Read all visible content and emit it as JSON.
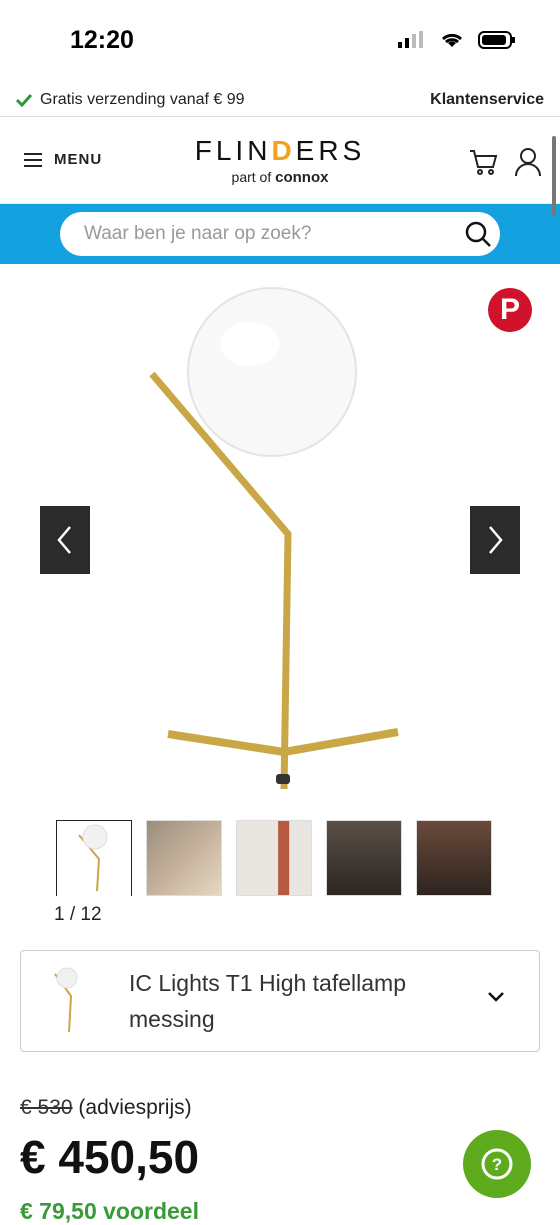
{
  "status_bar": {
    "time": "12:20"
  },
  "shipping": {
    "text": "Gratis verzending vanaf € 99",
    "service": "Klantenservice"
  },
  "header": {
    "menu_label": "MENU",
    "brand_part1": "FLIN",
    "brand_d": "D",
    "brand_part2": "ERS",
    "sub_prefix": "part of",
    "sub_brand": "connox"
  },
  "search": {
    "placeholder": "Waar ben je naar op zoek?"
  },
  "gallery": {
    "counter": "1 / 12"
  },
  "product": {
    "name": "IC Lights T1 High tafellamp messing",
    "old_price": "€ 530",
    "old_price_note": "(adviesprijs)",
    "price": "€ 450,50",
    "saving": "€ 79,50 voordeel"
  },
  "colors": {
    "accent_blue": "#14a1df",
    "help_green": "#5fab1e",
    "pinterest_red": "#d0132a",
    "brass": "#c9a646"
  },
  "icons": [
    "check-icon",
    "menu-icon",
    "cart-icon",
    "user-icon",
    "search-icon",
    "pinterest-icon",
    "chevron-left-icon",
    "chevron-right-icon",
    "chevron-down-icon",
    "help-icon"
  ]
}
